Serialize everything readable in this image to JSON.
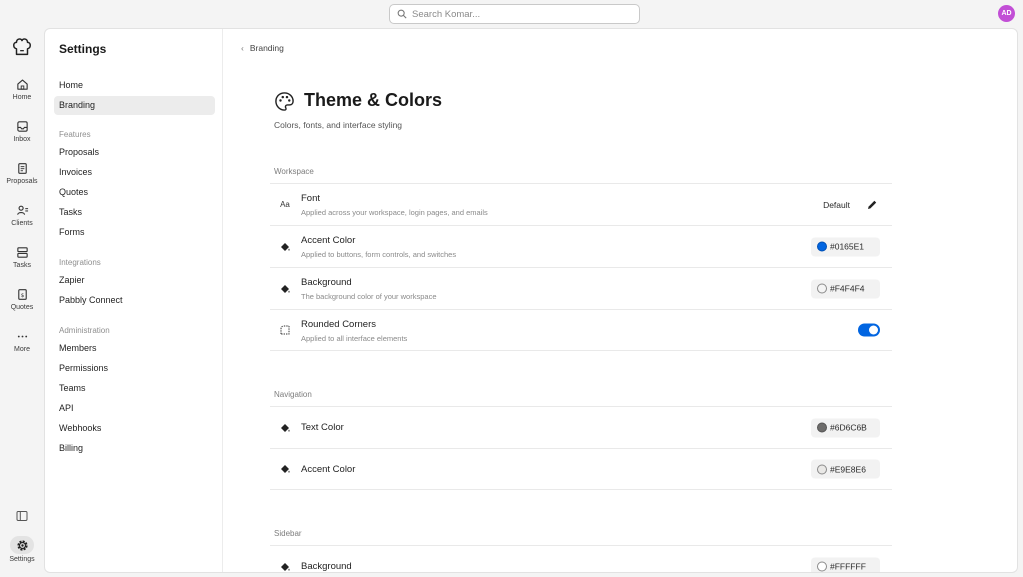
{
  "search": {
    "placeholder": "Search Komar..."
  },
  "user": {
    "initials": "AD",
    "color": "#c24fd6"
  },
  "rail": {
    "items": [
      {
        "label": "Home",
        "icon": "home-icon"
      },
      {
        "label": "Inbox",
        "icon": "inbox-icon"
      },
      {
        "label": "Proposals",
        "icon": "proposals-icon"
      },
      {
        "label": "Clients",
        "icon": "clients-icon"
      },
      {
        "label": "Tasks",
        "icon": "tasks-icon"
      },
      {
        "label": "Quotes",
        "icon": "quotes-icon"
      },
      {
        "label": "More",
        "icon": "more-icon"
      }
    ],
    "settings_label": "Settings"
  },
  "settings_nav": {
    "title": "Settings",
    "top": [
      "Home",
      "Branding"
    ],
    "active": "Branding",
    "groups": [
      {
        "label": "Features",
        "items": [
          "Proposals",
          "Invoices",
          "Quotes",
          "Tasks",
          "Forms"
        ]
      },
      {
        "label": "Integrations",
        "items": [
          "Zapier",
          "Pabbly Connect"
        ]
      },
      {
        "label": "Administration",
        "items": [
          "Members",
          "Permissions",
          "Teams",
          "API",
          "Webhooks",
          "Billing"
        ]
      }
    ]
  },
  "breadcrumb": {
    "back_label": "Branding"
  },
  "page": {
    "title": "Theme & Colors",
    "subtitle": "Colors, fonts, and interface styling"
  },
  "sections": {
    "workspace": {
      "label": "Workspace",
      "font": {
        "title": "Font",
        "desc": "Applied across your workspace, login pages, and emails",
        "value": "Default",
        "icon_text": "Aa"
      },
      "accent": {
        "title": "Accent Color",
        "desc": "Applied to buttons, form controls, and switches",
        "value": "#0165E1",
        "swatch": "#0165e1"
      },
      "background": {
        "title": "Background",
        "desc": "The background color of your workspace",
        "value": "#F4F4F4",
        "swatch": "#f4f4f4"
      },
      "corners": {
        "title": "Rounded Corners",
        "desc": "Applied to all interface elements",
        "enabled": true
      }
    },
    "navigation": {
      "label": "Navigation",
      "text_color": {
        "title": "Text Color",
        "value": "#6D6C6B",
        "swatch": "#6d6c6b"
      },
      "accent": {
        "title": "Accent Color",
        "value": "#E9E8E6",
        "swatch": "#e9e8e6"
      }
    },
    "sidebar": {
      "label": "Sidebar",
      "background": {
        "title": "Background",
        "value": "#FFFFFF",
        "swatch": "#ffffff"
      }
    }
  }
}
